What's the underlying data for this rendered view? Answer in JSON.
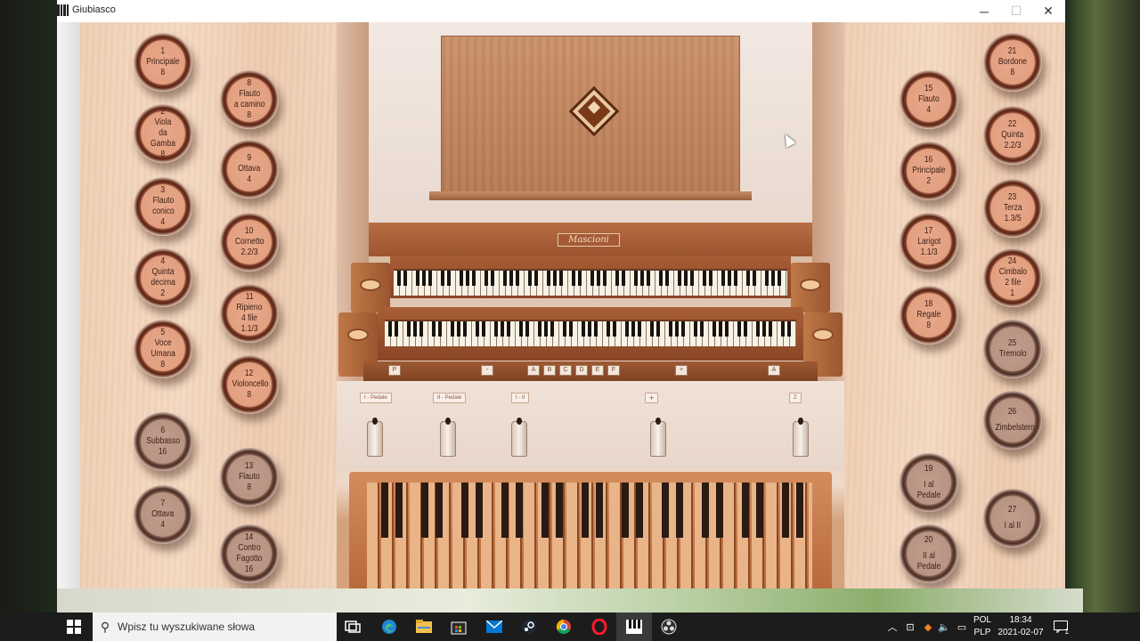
{
  "window": {
    "title": "Giubiasco",
    "minimize": "─",
    "maximize": "☐",
    "close": "✕"
  },
  "console": {
    "maker": "Mascioni"
  },
  "stops": [
    {
      "id": "1",
      "num": "1",
      "name": "Principale",
      "foot": "8",
      "state": "on"
    },
    {
      "id": "2",
      "num": "2",
      "name": "Viola\nda Gamba",
      "foot": "8",
      "state": "on"
    },
    {
      "id": "3",
      "num": "3",
      "name": "Flauto\nconico",
      "foot": "4",
      "state": "on"
    },
    {
      "id": "4",
      "num": "4",
      "name": "Quinta\ndecima",
      "foot": "2",
      "state": "on"
    },
    {
      "id": "5",
      "num": "5",
      "name": "Voce\nUmana",
      "foot": "8",
      "state": "on"
    },
    {
      "id": "6",
      "num": "6",
      "name": "Subbasso",
      "foot": "16",
      "state": "off"
    },
    {
      "id": "7",
      "num": "7",
      "name": "Ottava",
      "foot": "4",
      "state": "off"
    },
    {
      "id": "8",
      "num": "8",
      "name": "Flauto\na camino",
      "foot": "8",
      "state": "on"
    },
    {
      "id": "9",
      "num": "9",
      "name": "Ottava",
      "foot": "4",
      "state": "on"
    },
    {
      "id": "10",
      "num": "10",
      "name": "Cornetto",
      "foot": "2.2/3",
      "state": "on"
    },
    {
      "id": "11",
      "num": "11",
      "name": "Ripieno\n4 file",
      "foot": "1.1/3",
      "state": "on"
    },
    {
      "id": "12",
      "num": "12",
      "name": "Violoncello",
      "foot": "8",
      "state": "on"
    },
    {
      "id": "13",
      "num": "13",
      "name": "Flauto",
      "foot": "8",
      "state": "off"
    },
    {
      "id": "14",
      "num": "14",
      "name": "Contro\nFagotto",
      "foot": "16",
      "state": "off"
    },
    {
      "id": "15",
      "num": "15",
      "name": "Flauto",
      "foot": "4",
      "state": "on"
    },
    {
      "id": "16",
      "num": "16",
      "name": "Principale",
      "foot": "2",
      "state": "on"
    },
    {
      "id": "17",
      "num": "17",
      "name": "Larigot",
      "foot": "1.1/3",
      "state": "on"
    },
    {
      "id": "18",
      "num": "18",
      "name": "Regale",
      "foot": "8",
      "state": "on"
    },
    {
      "id": "19",
      "num": "19",
      "name": "I al Pedale",
      "foot": "",
      "state": "off"
    },
    {
      "id": "20",
      "num": "20",
      "name": "II al Pedale",
      "foot": "",
      "state": "off"
    },
    {
      "id": "21",
      "num": "21",
      "name": "Bordone",
      "foot": "8",
      "state": "on"
    },
    {
      "id": "22",
      "num": "22",
      "name": "Quinta",
      "foot": "2.2/3",
      "state": "on"
    },
    {
      "id": "23",
      "num": "23",
      "name": "Terza",
      "foot": "1.3/5",
      "state": "on"
    },
    {
      "id": "24",
      "num": "24",
      "name": "Cimbalo\n2 file",
      "foot": "1",
      "state": "on"
    },
    {
      "id": "25",
      "num": "25",
      "name": "Tremolo",
      "foot": "",
      "state": "off"
    },
    {
      "id": "26",
      "num": "26",
      "name": "Zimbelstern",
      "foot": "",
      "state": "off"
    },
    {
      "id": "27",
      "num": "27",
      "name": "I al II",
      "foot": "",
      "state": "off"
    }
  ],
  "pistons": [
    "P",
    "-",
    "A",
    "B",
    "C",
    "D",
    "E",
    "F",
    "+",
    "A"
  ],
  "couplers": [
    "I - Pedale",
    "II - Pedale",
    "I - II",
    "+",
    "Z"
  ],
  "taskbar": {
    "search_placeholder": "Wpisz tu wyszukiwane słowa",
    "lang_top": "POL",
    "lang_bottom": "PLP",
    "time": "18:34",
    "date": "2021-02-07",
    "notification_count": "1"
  },
  "icons": {
    "start": "windows-logo",
    "search": "search-glass",
    "task_view": "task-view",
    "edge": "edge",
    "explorer": "folder",
    "store": "store",
    "mail": "mail",
    "steam": "steam",
    "chrome": "chrome",
    "opera": "opera",
    "organ_app": "organ",
    "obs": "obs"
  }
}
